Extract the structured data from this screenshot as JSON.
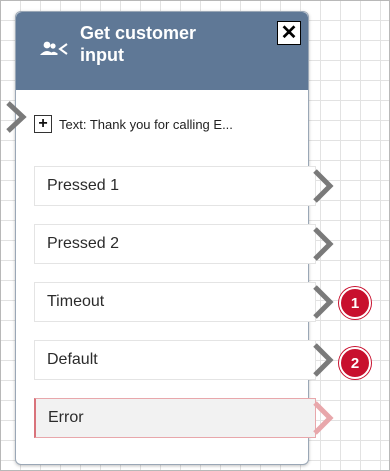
{
  "block": {
    "title": "Get customer input",
    "title_line1": "Get customer",
    "title_line2": "input",
    "close_symbol": "✕",
    "header_icon": "users-branch-icon",
    "prompt": {
      "icon": "plus-icon",
      "text": "Text: Thank you for calling E..."
    },
    "branches": [
      {
        "label": "Pressed 1",
        "badge": null
      },
      {
        "label": "Pressed 2",
        "badge": null
      },
      {
        "label": "Timeout",
        "badge": "1"
      },
      {
        "label": "Default",
        "badge": "2"
      },
      {
        "label": "Error",
        "badge": null
      }
    ]
  },
  "colors": {
    "header": "#5f7896",
    "badge": "#c8102e",
    "arrow": "#7a7a7a",
    "error_arrow": "#e8a7ab"
  }
}
